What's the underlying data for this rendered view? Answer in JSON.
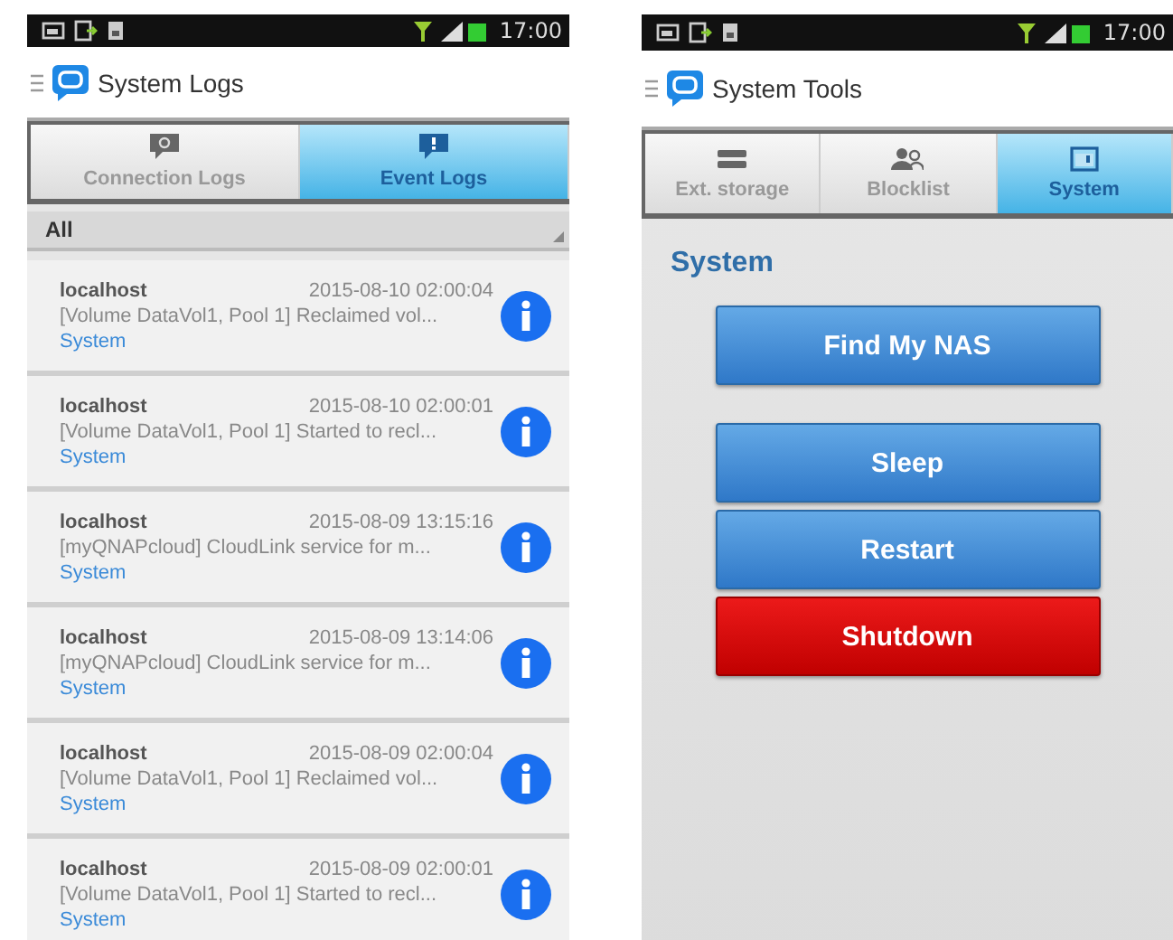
{
  "screens": [
    {
      "kind": "logs",
      "status_bar": {
        "time": "17:00"
      },
      "title": "System Logs",
      "tabs": [
        {
          "label": "Connection Logs",
          "kind": "connection",
          "selected": false
        },
        {
          "label": "Event Logs",
          "kind": "event",
          "selected": true
        }
      ],
      "filter": "All",
      "logs": [
        {
          "host": "localhost",
          "time": "2015-08-10 02:00:04",
          "message": "[Volume DataVol1, Pool 1] Reclaimed vol...",
          "category": "System"
        },
        {
          "host": "localhost",
          "time": "2015-08-10 02:00:01",
          "message": "[Volume DataVol1, Pool 1] Started to recl...",
          "category": "System"
        },
        {
          "host": "localhost",
          "time": "2015-08-09 13:15:16",
          "message": "[myQNAPcloud] CloudLink service for m...",
          "category": "System"
        },
        {
          "host": "localhost",
          "time": "2015-08-09 13:14:06",
          "message": "[myQNAPcloud] CloudLink service for m...",
          "category": "System"
        },
        {
          "host": "localhost",
          "time": "2015-08-09 02:00:04",
          "message": "[Volume DataVol1, Pool 1] Reclaimed vol...",
          "category": "System"
        },
        {
          "host": "localhost",
          "time": "2015-08-09 02:00:01",
          "message": "[Volume DataVol1, Pool 1] Started to recl...",
          "category": "System"
        }
      ]
    },
    {
      "kind": "tools",
      "status_bar": {
        "time": "17:00"
      },
      "title": "System Tools",
      "tabs": [
        {
          "label": "Ext. storage",
          "kind": "storage",
          "selected": false
        },
        {
          "label": "Blocklist",
          "kind": "people",
          "selected": false
        },
        {
          "label": "System",
          "kind": "window",
          "selected": true
        }
      ],
      "section": "System",
      "buttons": [
        {
          "label": "Find My NAS",
          "kind": "normal"
        },
        {
          "label": "Sleep",
          "kind": "normal"
        },
        {
          "label": "Restart",
          "kind": "normal"
        },
        {
          "label": "Shutdown",
          "kind": "danger"
        }
      ]
    }
  ]
}
